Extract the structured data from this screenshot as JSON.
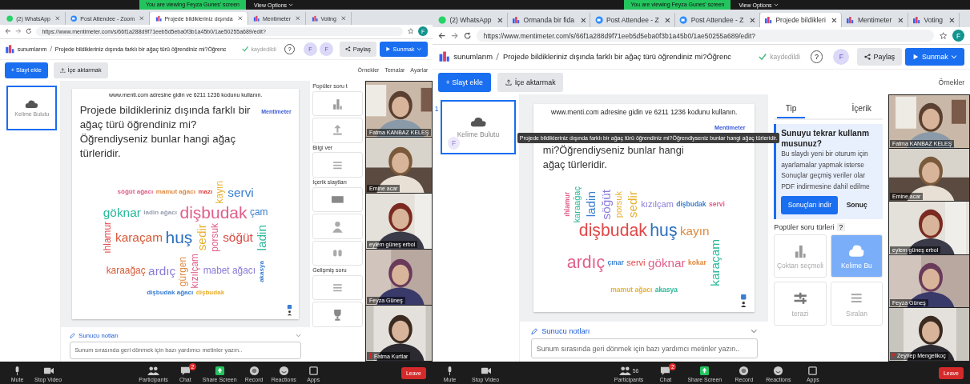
{
  "panes": [
    {
      "zoom_bar": {
        "notice": "You are viewing Feyza Gunes' screen",
        "view_options": "View Options"
      },
      "browser": {
        "tabs": [
          {
            "label": "(2) WhatsApp",
            "kind": "whatsapp",
            "selected": false
          },
          {
            "label": "Post Attendee - Zoom",
            "kind": "zoom",
            "selected": false
          },
          {
            "label": "Projede bildikleriniz dışında",
            "kind": "menti",
            "selected": true
          },
          {
            "label": "Mentimeter",
            "kind": "menti",
            "selected": false
          },
          {
            "label": "Voting",
            "kind": "menti",
            "selected": false
          }
        ],
        "url": "https://www.mentimeter.com/s/66f1a288d9f71eeb5d5eba0f3b1a45b0/1ae50255a689/edit?",
        "profile": "F"
      },
      "header": {
        "root": "sunumlarım",
        "title": "Projede bildikleriniz dışında farklı bir ağaç türü öğrendiniz mi?Öğrenc",
        "saved": "kaydedildi",
        "help": "?",
        "avatars": [
          "F",
          "F"
        ],
        "share": "Paylaş",
        "present": "Sunmak"
      },
      "toolbar": {
        "add_slide": "+ Slayt ekle",
        "import": "İçe aktarmak",
        "links": [
          "Örnekler",
          "Temalar",
          "Ayarlar"
        ]
      },
      "thumbnail": {
        "label": "Kelime Bulutu",
        "selected": true
      },
      "slide": {
        "instruction": "www.menti.com adresine gidin ve 6211 1236 kodunu kullanın.",
        "question": "Projede bildikleriniz dışında farklı bir ağaç türü öğrendiniz mi?Öğrendiyseniz bunlar hangi ağaç türleridir.",
        "brand": "Mentimeter",
        "words": [
          {
            "text": "söğüt ağacı",
            "color": "#e0608a",
            "kind": "small",
            "vertical": false
          },
          {
            "text": "mamut ağacı",
            "color": "#e08a40",
            "kind": "small",
            "vertical": false
          },
          {
            "text": "mazı",
            "color": "#e04848",
            "kind": "small",
            "vertical": false
          },
          {
            "text": "kayın",
            "color": "#e8b030",
            "kind": "mid",
            "vertical": true
          },
          {
            "text": "servi",
            "color": "#3a7fd0",
            "kind": "big",
            "vertical": false
          },
          {
            "text": "göknar",
            "color": "#2ab89a",
            "kind": "big",
            "vertical": false
          },
          {
            "text": "ladin ağacı",
            "color": "#9aa0b0",
            "kind": "small",
            "vertical": false
          },
          {
            "text": "dişbudak",
            "color": "#e0608a",
            "kind": "huge",
            "vertical": false
          },
          {
            "text": "çam",
            "color": "#3a7fd0",
            "kind": "mid",
            "vertical": false
          },
          {
            "text": "ıhlamur",
            "color": "#e04848",
            "kind": "mid",
            "vertical": true
          },
          {
            "text": "karaçam",
            "color": "#d85a38",
            "kind": "big",
            "vertical": false
          },
          {
            "text": "huş",
            "color": "#2a6fc0",
            "kind": "huge",
            "vertical": false
          },
          {
            "text": "sedir",
            "color": "#e8b030",
            "kind": "big",
            "vertical": true
          },
          {
            "text": "porsuk",
            "color": "#e0608a",
            "kind": "mid",
            "vertical": true
          },
          {
            "text": "söğüt",
            "color": "#d84840",
            "kind": "big",
            "vertical": false
          },
          {
            "text": "ladin",
            "color": "#2ab89a",
            "kind": "big",
            "vertical": true
          },
          {
            "text": "karaağaç",
            "color": "#d85a38",
            "kind": "mid",
            "vertical": false
          },
          {
            "text": "ardıç",
            "color": "#8a7ad8",
            "kind": "big",
            "vertical": false
          },
          {
            "text": "gürgen",
            "color": "#e08a40",
            "kind": "mid",
            "vertical": true
          },
          {
            "text": "kızılçam",
            "color": "#e0608a",
            "kind": "mid",
            "vertical": true
          },
          {
            "text": "mabet ağacı",
            "color": "#8a7ad8",
            "kind": "mid",
            "vertical": false
          },
          {
            "text": "akasya",
            "color": "#3a7fd0",
            "kind": "small",
            "vertical": true
          },
          {
            "text": "dişbudak ağacı",
            "color": "#3a7fd0",
            "kind": "small",
            "vertical": false
          },
          {
            "text": "dişbudak",
            "color": "#e8b030",
            "kind": "small",
            "vertical": false
          }
        ]
      },
      "notes": {
        "title": "Sunucu notları",
        "placeholder": "Sunum sırasında geri dönmek için bazı yardımcı metinler yazın.."
      },
      "panel": {
        "sections": [
          {
            "title": "Popüler soru t",
            "cards": [
              {
                "kind": "bars",
                "selected": false
              },
              {
                "kind": "upload",
                "selected": false
              }
            ]
          },
          {
            "title": "Bilgi ver",
            "cards": [
              {
                "kind": "lines",
                "selected": false
              }
            ]
          },
          {
            "title": "İçerik slaytları",
            "cards": [
              {
                "kind": "dash",
                "selected": false
              },
              {
                "kind": "person",
                "selected": false
              },
              {
                "kind": "quote",
                "selected": false
              }
            ]
          },
          {
            "title": "Gelişmiş soru",
            "cards": [
              {
                "kind": "lines",
                "selected": false
              },
              {
                "kind": "trophy",
                "selected": false
              }
            ]
          }
        ]
      },
      "participants": [
        {
          "name": "Fatma KANBAZ KELEŞ",
          "muted": false
        },
        {
          "name": "Emine acar",
          "muted": false
        },
        {
          "name": "eylem güneş erbol",
          "muted": false
        },
        {
          "name": "Feyza Güneş",
          "muted": false
        },
        {
          "name": "Fatma Kurtlar",
          "muted": true
        }
      ],
      "meeting_bar": {
        "items": [
          {
            "label": "Mute",
            "kind": "mic"
          },
          {
            "label": "Stop Video",
            "kind": "camera"
          },
          {
            "label": "Participants",
            "kind": "people"
          },
          {
            "label": "Chat",
            "kind": "chat",
            "badge": "2"
          },
          {
            "label": "Share Screen",
            "kind": "share"
          },
          {
            "label": "Record",
            "kind": "record"
          },
          {
            "label": "Reactions",
            "kind": "smile"
          },
          {
            "label": "Apps",
            "kind": "apps"
          }
        ],
        "leave": "Leave"
      }
    },
    {
      "zoom_bar": {
        "notice": "You are viewing Feyza Gunes' screen",
        "view_options": "View Options"
      },
      "browser": {
        "tabs": [
          {
            "label": "(2) WhatsApp",
            "kind": "whatsapp",
            "selected": false
          },
          {
            "label": "Ormanda bir fida",
            "kind": "menti",
            "selected": false
          },
          {
            "label": "Post Attendee - Z",
            "kind": "zoom",
            "selected": false
          },
          {
            "label": "Post Attendee - Z",
            "kind": "zoom",
            "selected": false
          },
          {
            "label": "Projede bildikleri",
            "kind": "menti",
            "selected": true
          },
          {
            "label": "Mentimeter",
            "kind": "menti",
            "selected": false
          },
          {
            "label": "Voting",
            "kind": "menti",
            "selected": false
          }
        ],
        "url": "https://www.mentimeter.com/s/66f1a288d9f71eeb5d5eba0f3b1a45b0/1ae50255a689/edit?",
        "profile": "F"
      },
      "header": {
        "root": "sunumlarım",
        "title": "Projede bildikleriniz dışında farklı bir ağaç türü öğrendiniz mi?Öğrenc",
        "saved": "kaydedildi",
        "help": "?",
        "avatars": [
          "F"
        ],
        "share": "Paylaş",
        "present": "Sunmak"
      },
      "toolbar": {
        "add_slide": "+ Slayt ekle",
        "import": "İçe aktarmak",
        "links": [
          "Örnekler"
        ]
      },
      "thumbnail": {
        "number": "1",
        "label": "Kelime Bulutu",
        "avatar": "F",
        "selected": true
      },
      "tooltip": "Projede bildikleriniz dışında farklı bir ağaç türü öğrendiniz mi?Öğrendiyseniz bunlar hangi ağaç türleridir.",
      "slide": {
        "instruction": "www.menti.com adresine gidin ve 6211 1236 kodunu kullanın.",
        "question": "mi?Öğrendiyseniz bunlar hangi ağaç türleridir.",
        "brand": "Mentimeter",
        "words": [
          {
            "text": "ıhlamur",
            "color": "#e0608a",
            "kind": "small",
            "vertical": true
          },
          {
            "text": "karaağaç",
            "color": "#2ab89a",
            "kind": "mid",
            "vertical": true
          },
          {
            "text": "ladin",
            "color": "#3a7fd0",
            "kind": "big",
            "vertical": true
          },
          {
            "text": "söğüt",
            "color": "#8a7ad8",
            "kind": "big",
            "vertical": true
          },
          {
            "text": "porsuk",
            "color": "#e8b030",
            "kind": "mid",
            "vertical": true
          },
          {
            "text": "sedir",
            "color": "#e8b030",
            "kind": "big",
            "vertical": true
          },
          {
            "text": "kızılçam",
            "color": "#8a7ad8",
            "kind": "mid",
            "vertical": false
          },
          {
            "text": "dişbudak",
            "color": "#3a7fd0",
            "kind": "small",
            "vertical": false
          },
          {
            "text": "servi",
            "color": "#e0608a",
            "kind": "small",
            "vertical": false
          },
          {
            "text": "dişbudak",
            "color": "#e04848",
            "kind": "huge",
            "vertical": false
          },
          {
            "text": "huş",
            "color": "#2a6fc0",
            "kind": "huge",
            "vertical": false
          },
          {
            "text": "kayın",
            "color": "#e08a40",
            "kind": "big",
            "vertical": false
          },
          {
            "text": "ardıç",
            "color": "#e0608a",
            "kind": "huge",
            "vertical": false
          },
          {
            "text": "çınar",
            "color": "#3a7fd0",
            "kind": "small",
            "vertical": false
          },
          {
            "text": "servi",
            "color": "#e04848",
            "kind": "mid",
            "vertical": false
          },
          {
            "text": "göknar",
            "color": "#e0608a",
            "kind": "big",
            "vertical": false
          },
          {
            "text": "kokar",
            "color": "#e08a40",
            "kind": "small",
            "vertical": false
          },
          {
            "text": "karaçam",
            "color": "#2ab89a",
            "kind": "big",
            "vertical": true
          },
          {
            "text": "mamut ağacı",
            "color": "#e8b030",
            "kind": "small",
            "vertical": false
          },
          {
            "text": "akasya",
            "color": "#2ab89a",
            "kind": "small",
            "vertical": false
          }
        ]
      },
      "notes": {
        "title": "Sunucu notları",
        "placeholder": "Sunum sırasında geri dönmek için bazı yardımcı metinler yazın.."
      },
      "panel": {
        "tabs": [
          {
            "label": "Tip",
            "selected": true
          },
          {
            "label": "İçerik",
            "selected": false
          }
        ],
        "promo": {
          "title": "Sunuyu tekrar kullanm",
          "title_2": "musunuz?",
          "lines": [
            "Bu slaydı yeni bir oturum için",
            "ayarlamalar yapmak isterse",
            "Sonuçlar geçmiş veriler olar",
            "PDF indirmesine dahil edilme"
          ],
          "primary": "Sonuçları indir",
          "secondary": "Sonuç"
        },
        "sections": [
          {
            "title": "Popüler soru türleri",
            "help": "?",
            "cards": [
              {
                "kind": "bars",
                "label": "Çoktan seçmeli",
                "selected": false
              },
              {
                "kind": "cloud",
                "label": "Kelime Bu",
                "selected": true
              },
              {
                "kind": "scale",
                "label": "terazi",
                "selected": false
              },
              {
                "kind": "list",
                "label": "Sıralan",
                "selected": false
              }
            ]
          }
        ]
      },
      "participants": [
        {
          "name": "Fatma KANBAZ KELEŞ",
          "muted": false
        },
        {
          "name": "Emine acar",
          "muted": false
        },
        {
          "name": "eylem güneş erbol",
          "muted": false
        },
        {
          "name": "Feyza Güneş",
          "muted": false
        },
        {
          "name": "Zeynep Mengelikoç",
          "muted": true
        }
      ],
      "meeting_bar": {
        "items": [
          {
            "label": "Mute",
            "kind": "mic"
          },
          {
            "label": "Stop Video",
            "kind": "camera"
          },
          {
            "label": "Participants",
            "kind": "people",
            "count": "56"
          },
          {
            "label": "Chat",
            "kind": "chat",
            "badge": "2"
          },
          {
            "label": "Share Screen",
            "kind": "share"
          },
          {
            "label": "Record",
            "kind": "record"
          },
          {
            "label": "Reactions",
            "kind": "smile"
          },
          {
            "label": "Apps",
            "kind": "apps"
          }
        ],
        "leave": "Leave"
      }
    }
  ]
}
